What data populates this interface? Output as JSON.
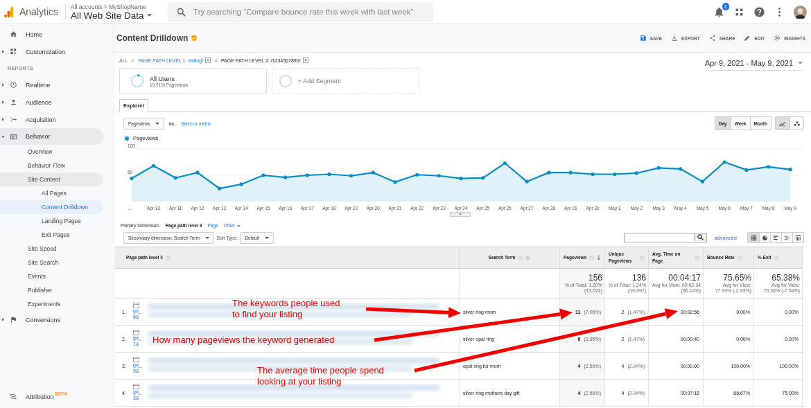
{
  "app": {
    "name": "Analytics",
    "accounts": [
      "All accounts",
      "MyShopName"
    ],
    "view": "All Web Site Data"
  },
  "search": {
    "placeholder": "Try searching “Compare bounce rate this week with last week”"
  },
  "notifications": {
    "count": "2"
  },
  "sidebar": {
    "items": [
      {
        "label": "Home",
        "selected": false
      },
      {
        "label": "Customization",
        "selected": false,
        "expanded": false
      }
    ],
    "section": "REPORTS",
    "reports": [
      {
        "label": "Realtime",
        "selected": false,
        "expanded": false
      },
      {
        "label": "Audience",
        "selected": false,
        "expanded": false
      },
      {
        "label": "Acquisition",
        "selected": false,
        "expanded": false
      },
      {
        "label": "Behavior",
        "selected": false,
        "expanded": true,
        "children": [
          {
            "label": "Overview",
            "selected": false
          },
          {
            "label": "Behavior Flow",
            "selected": false
          },
          {
            "label": "Site Content",
            "selected": false,
            "expanded": true,
            "children": [
              {
                "label": "All Pages",
                "selected": false
              },
              {
                "label": "Content Drilldown",
                "selected": true
              },
              {
                "label": "Landing Pages",
                "selected": false
              },
              {
                "label": "Exit Pages",
                "selected": false
              }
            ]
          },
          {
            "label": "Site Speed",
            "selected": false,
            "expanded": false
          },
          {
            "label": "Site Search",
            "selected": false,
            "expanded": false
          },
          {
            "label": "Events",
            "selected": false,
            "expanded": false
          },
          {
            "label": "Publisher",
            "selected": false,
            "expanded": false
          },
          {
            "label": "Experiments",
            "selected": false
          }
        ]
      },
      {
        "label": "Conversions",
        "selected": false,
        "expanded": false
      }
    ],
    "footer": {
      "label": "Attribution",
      "badge": "BETA"
    }
  },
  "page": {
    "title": "Content Drilldown",
    "actions": [
      "SAVE",
      "EXPORT",
      "SHARE",
      "EDIT",
      "INSIGHTS"
    ],
    "breadcrumb": [
      "ALL",
      "PAGE PATH LEVEL 1: /listing/",
      "PAGE PATH LEVEL 2: /1234567890/"
    ],
    "date_range": "Apr 9, 2021 - May 9, 2021"
  },
  "segments": [
    {
      "name": "All Users",
      "detail": "10.91% Pageviews"
    }
  ],
  "add_segment": "+ Add Segment",
  "tabs": [
    {
      "label": "Explorer",
      "selected": true
    }
  ],
  "metric": {
    "value": "Pageviews",
    "vs": "vs.",
    "link": "Select a metric"
  },
  "granularity": [
    {
      "label": "Day",
      "selected": true
    },
    {
      "label": "Week",
      "selected": false
    },
    {
      "label": "Month",
      "selected": false
    }
  ],
  "chart_types": [
    {
      "selected": true
    },
    {
      "selected": false
    }
  ],
  "chart_data": {
    "type": "area",
    "ylim": [
      0,
      100
    ],
    "yticks": [
      50,
      100
    ],
    "categories": [
      "...",
      "Apr 10",
      "Apr 11",
      "Apr 12",
      "Apr 13",
      "Apr 14",
      "Apr 15",
      "Apr 16",
      "Apr 17",
      "Apr 18",
      "Apr 19",
      "Apr 20",
      "Apr 21",
      "Apr 22",
      "Apr 23",
      "Apr 24",
      "Apr 25",
      "Apr 26",
      "Apr 27",
      "Apr 28",
      "Apr 29",
      "Apr 30",
      "May 1",
      "May 2",
      "May 3",
      "May 4",
      "May 5",
      "May 6",
      "May 7",
      "May 8",
      "May 9"
    ],
    "series": [
      {
        "name": "Pageviews",
        "color": "#058dc7",
        "values": [
          44,
          68,
          45,
          55,
          25,
          33,
          50,
          46,
          50,
          52,
          49,
          55,
          37,
          51,
          49,
          44,
          45,
          73,
          38,
          55,
          55,
          52,
          52,
          54,
          64,
          62,
          38,
          75,
          60,
          66,
          61
        ]
      }
    ]
  },
  "dimensions": {
    "label": "Primary Dimension:",
    "options": [
      {
        "label": "Page path level 3",
        "selected": true
      },
      {
        "label": "Page",
        "selected": false
      },
      {
        "label": "Other",
        "selected": false
      }
    ]
  },
  "secondary": {
    "dimension": "Secondary dimension: Search Term",
    "sort_label": "Sort Type:",
    "sort": "Default",
    "advanced": "advanced"
  },
  "view_modes": [
    {
      "selected": true
    },
    {
      "selected": false
    },
    {
      "selected": false
    },
    {
      "selected": false
    },
    {
      "selected": false
    }
  ],
  "table": {
    "columns": [
      {
        "label": "Page path level 3",
        "sorted": false,
        "removable": false
      },
      {
        "label": "Search Term",
        "sorted": false,
        "removable": true
      },
      {
        "label": "Pageviews",
        "sorted": true,
        "removable": false
      },
      {
        "label": "Unique Pageviews",
        "sorted": false,
        "removable": false
      },
      {
        "label": "Avg. Time on Page",
        "sorted": false,
        "removable": false
      },
      {
        "label": "Bounce Rate",
        "sorted": false,
        "removable": false
      },
      {
        "label": "% Exit",
        "sorted": false,
        "removable": false
      }
    ],
    "totals": [
      {
        "value": "156",
        "lines": [
          "% of Total: 1.20%",
          "(13,021)"
        ]
      },
      {
        "value": "136",
        "lines": [
          "% of Total: 1.24%",
          "(10,997)"
        ]
      },
      {
        "value": "00:04:17",
        "lines": [
          "Avg for View: 00:02:34",
          "(66.14%)"
        ]
      },
      {
        "value": "75.65%",
        "lines": [
          "Avg for View:",
          "77.93% (-2.93%)"
        ]
      },
      {
        "value": "65.38%",
        "lines": [
          "Avg for View:",
          "70.33% (-7.04%)"
        ]
      }
    ],
    "rows": [
      {
        "index": "1.",
        "path": [
          "ga_",
          "8&"
        ],
        "search_term": "silver ring mom",
        "pageviews": "11",
        "pageviews_pct": "(7.05%)",
        "unique": "2",
        "unique_pct": "(1.47%)",
        "avg_time": "00:02:56",
        "bounce": "0.00%",
        "exit": "0.00%"
      },
      {
        "index": "2.",
        "path": [
          "ga_",
          "1&"
        ],
        "search_term": "silver opal ring",
        "pageviews": "6",
        "pageviews_pct": "(3.85%)",
        "unique": "2",
        "unique_pct": "(1.47%)",
        "avg_time": "00:00:40",
        "bounce": "0.00%",
        "exit": "0.00%"
      },
      {
        "index": "3.",
        "path": [
          "ga_",
          "9&"
        ],
        "search_term": "opal ring for mom",
        "pageviews": "4",
        "pageviews_pct": "(2.56%)",
        "unique": "4",
        "unique_pct": "(2.94%)",
        "avg_time": "00:00:00",
        "bounce": "100.00%",
        "exit": "100.00%"
      },
      {
        "index": "4.",
        "path": [
          "ga_",
          "3&"
        ],
        "search_term": "silver ring mothers day gift",
        "pageviews": "4",
        "pageviews_pct": "(2.56%)",
        "unique": "4",
        "unique_pct": "(2.94%)",
        "avg_time": "00:07:18",
        "bounce": "66.67%",
        "exit": "75.00%"
      }
    ]
  },
  "annotations": [
    {
      "lines": [
        "The keywords people used",
        "to find your listing"
      ]
    },
    {
      "lines": [
        "How many pageviews the keyword generated"
      ]
    },
    {
      "lines": [
        "The average time people spend",
        "looking at your listing"
      ]
    }
  ]
}
